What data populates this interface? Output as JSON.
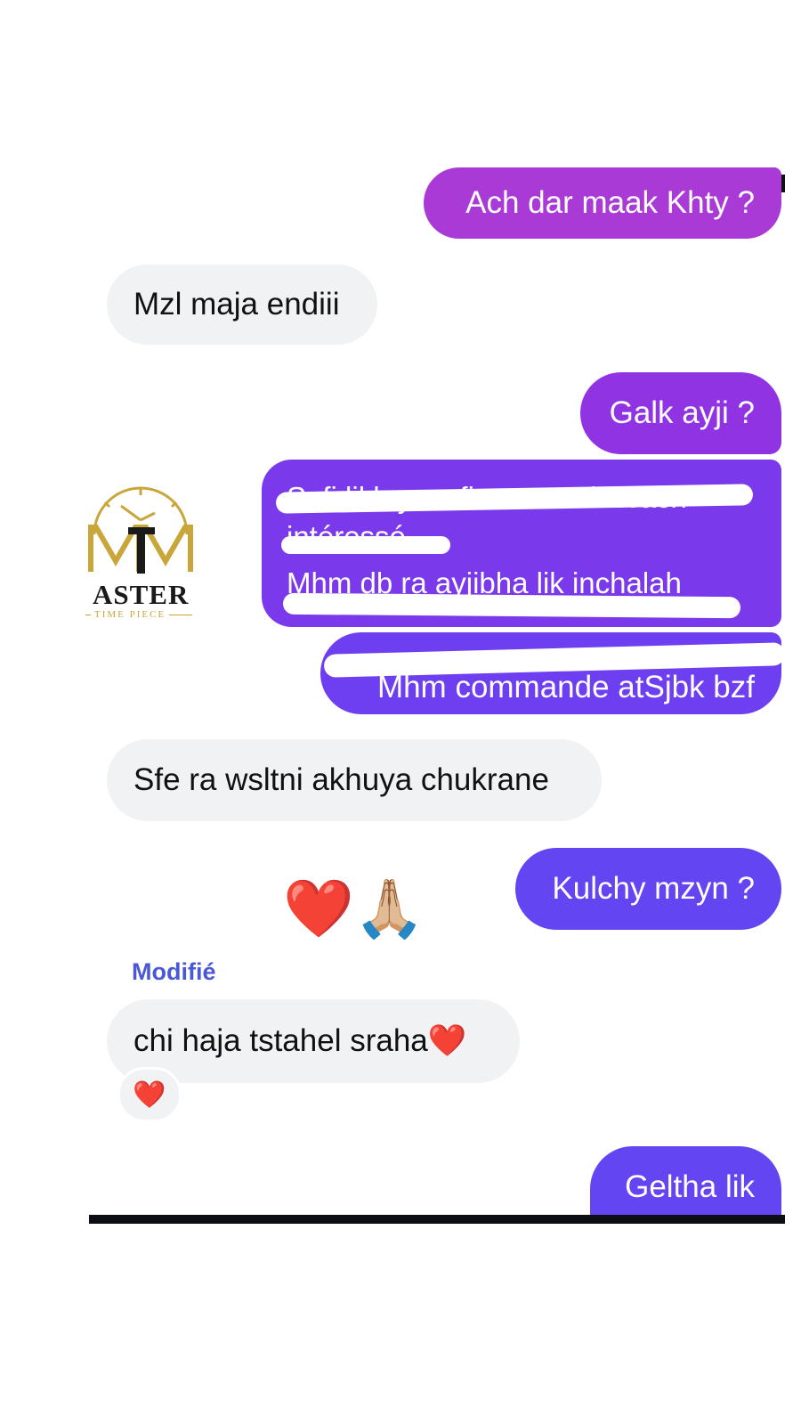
{
  "messages": {
    "m1": "Ach dar maak Khty ?",
    "m2": "Mzl maja endiii",
    "m3": "Galk ayji ?",
    "m4_line1": "Safi likh yconfirme maak Wach",
    "m4_line2": "intéressé",
    "m4_line3": "Mhm db ra ayjibha lik inchalah",
    "m5": "Mhm commande atSjbk bzf",
    "m6": "Sfe ra wsltni akhuya chukrane",
    "m7": "Kulchy mzyn ?",
    "m8_emojis": "❤️🙏🏼",
    "m9_edited": "Modifié",
    "m9": "chi haja tstahel sraha❤️",
    "m9_reaction": "❤️",
    "m10": "Geltha lik"
  },
  "logo": {
    "word": "ASTER",
    "tagline": "TIME PIECE",
    "monogram": "TM"
  },
  "colors": {
    "incoming_bg": "#f0f2f4",
    "outgoing_1": "#a93ad6",
    "outgoing_2": "#9033e2",
    "outgoing_3": "#7a39ea",
    "outgoing_4": "#6d3ff0",
    "outgoing_5": "#6346f2",
    "edited_label": "#4a57d6",
    "logo_gold": "#c9a63a"
  }
}
